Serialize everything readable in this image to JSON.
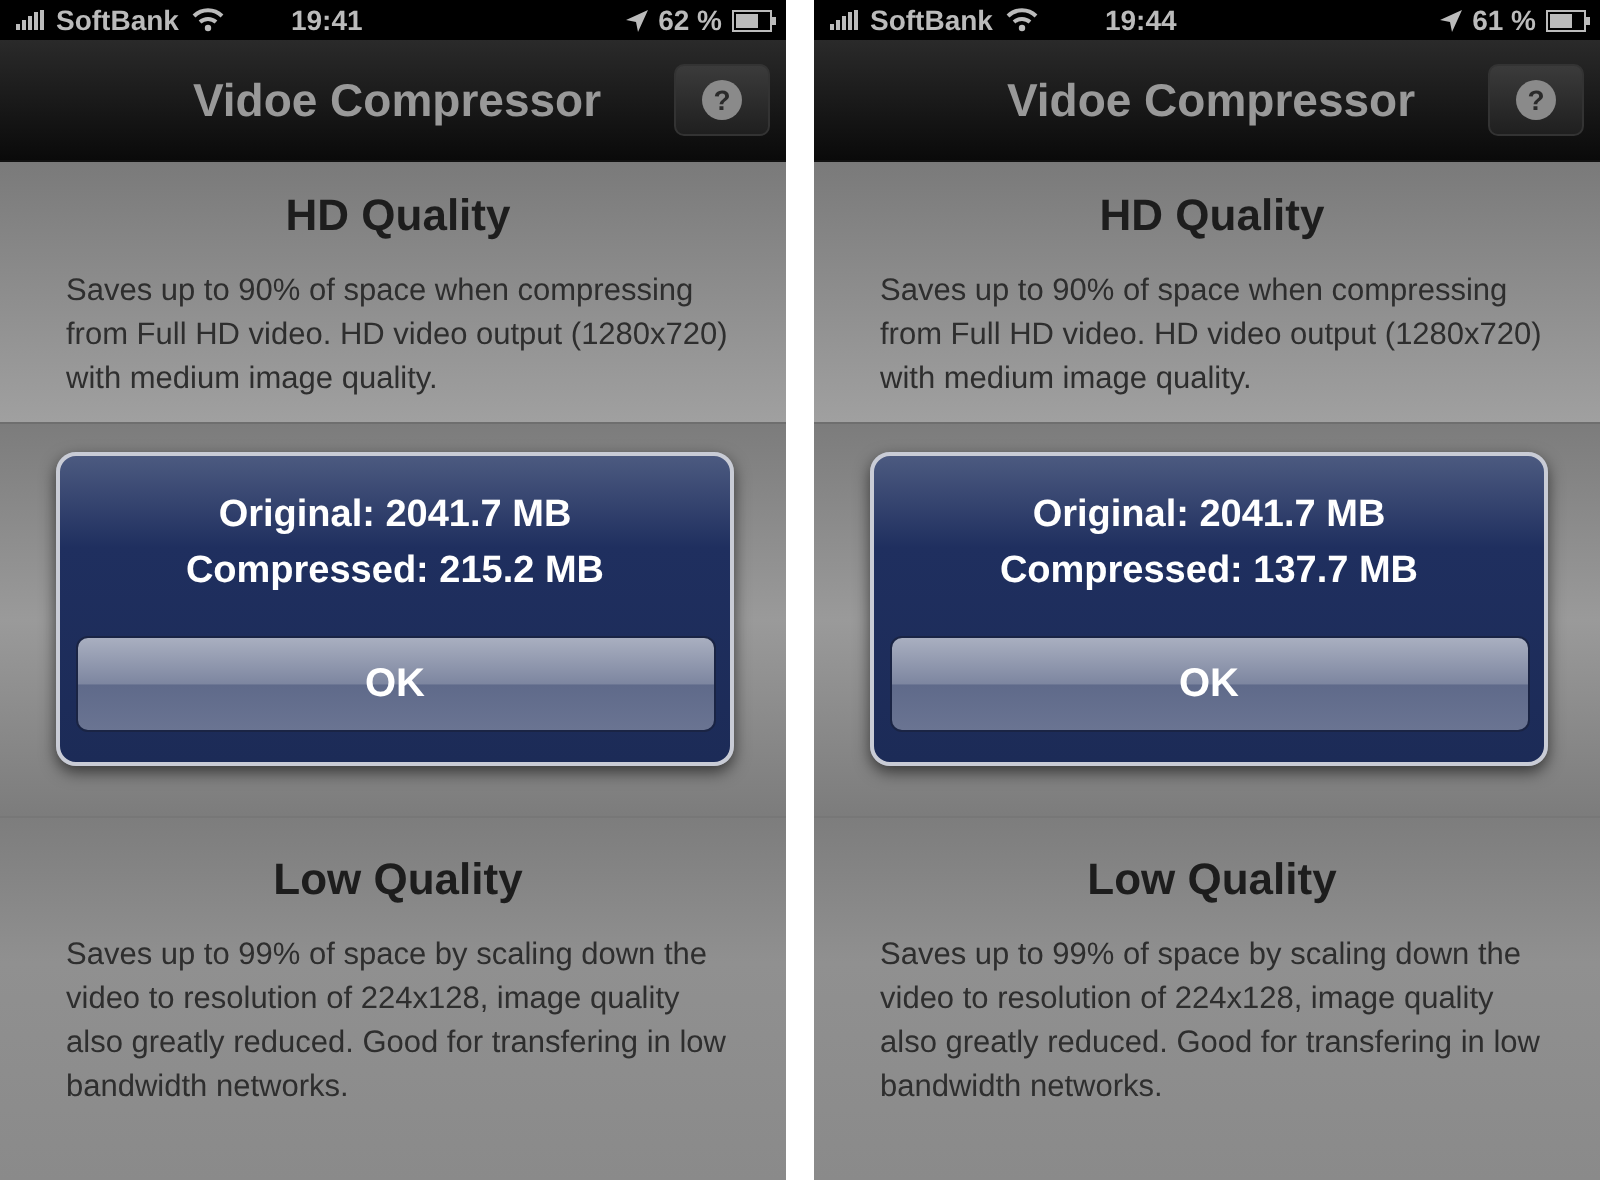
{
  "screens": [
    {
      "status_bar": {
        "carrier": "SoftBank",
        "time": "19:41",
        "battery": "62 %"
      },
      "nav_bar": {
        "title": "Vidoe Compressor",
        "help_button": "?"
      },
      "sections": [
        {
          "title": "HD Quality",
          "description": "Saves up to 90% of space when compressing from Full HD video. HD video output (1280x720) with medium image quality."
        },
        {
          "title": "Low Quality",
          "description": "Saves up to 99% of space by scaling down the video to resolution of 224x128, image quality also greatly reduced. Good for transfering in low bandwidth networks."
        }
      ],
      "alert": {
        "lines": [
          "Original: 2041.7 MB",
          "Compressed: 215.2 MB"
        ],
        "button": "OK"
      }
    },
    {
      "status_bar": {
        "carrier": "SoftBank",
        "time": "19:44",
        "battery": "61 %"
      },
      "nav_bar": {
        "title": "Vidoe Compressor",
        "help_button": "?"
      },
      "sections": [
        {
          "title": "HD Quality",
          "description": "Saves up to 90% of space when compressing from Full HD video. HD video output (1280x720) with medium image quality."
        },
        {
          "title": "Low Quality",
          "description": "Saves up to 99% of space by scaling down the video to resolution of 224x128, image quality also greatly reduced. Good for transfering in low bandwidth networks."
        }
      ],
      "alert": {
        "lines": [
          "Original: 2041.7 MB",
          "Compressed: 137.7 MB"
        ],
        "button": "OK"
      }
    }
  ]
}
